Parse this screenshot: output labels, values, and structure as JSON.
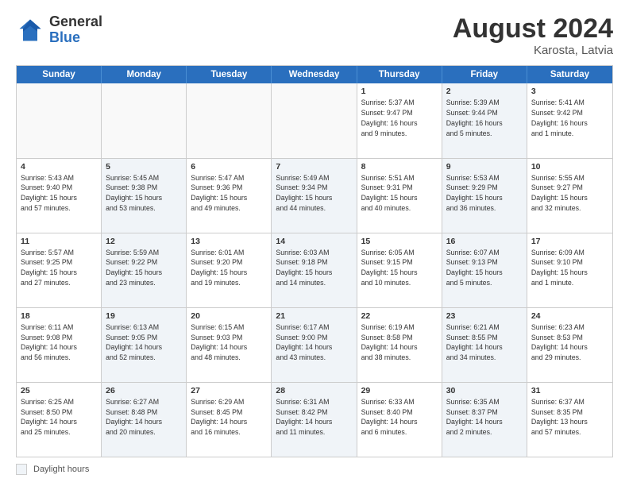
{
  "header": {
    "logo_general": "General",
    "logo_blue": "Blue",
    "month_year": "August 2024",
    "location": "Karosta, Latvia"
  },
  "days_of_week": [
    "Sunday",
    "Monday",
    "Tuesday",
    "Wednesday",
    "Thursday",
    "Friday",
    "Saturday"
  ],
  "weeks": [
    [
      {
        "day": "",
        "info": "",
        "shaded": false,
        "empty": true
      },
      {
        "day": "",
        "info": "",
        "shaded": false,
        "empty": true
      },
      {
        "day": "",
        "info": "",
        "shaded": false,
        "empty": true
      },
      {
        "day": "",
        "info": "",
        "shaded": false,
        "empty": true
      },
      {
        "day": "1",
        "info": "Sunrise: 5:37 AM\nSunset: 9:47 PM\nDaylight: 16 hours\nand 9 minutes.",
        "shaded": false,
        "empty": false
      },
      {
        "day": "2",
        "info": "Sunrise: 5:39 AM\nSunset: 9:44 PM\nDaylight: 16 hours\nand 5 minutes.",
        "shaded": true,
        "empty": false
      },
      {
        "day": "3",
        "info": "Sunrise: 5:41 AM\nSunset: 9:42 PM\nDaylight: 16 hours\nand 1 minute.",
        "shaded": false,
        "empty": false
      }
    ],
    [
      {
        "day": "4",
        "info": "Sunrise: 5:43 AM\nSunset: 9:40 PM\nDaylight: 15 hours\nand 57 minutes.",
        "shaded": false,
        "empty": false
      },
      {
        "day": "5",
        "info": "Sunrise: 5:45 AM\nSunset: 9:38 PM\nDaylight: 15 hours\nand 53 minutes.",
        "shaded": true,
        "empty": false
      },
      {
        "day": "6",
        "info": "Sunrise: 5:47 AM\nSunset: 9:36 PM\nDaylight: 15 hours\nand 49 minutes.",
        "shaded": false,
        "empty": false
      },
      {
        "day": "7",
        "info": "Sunrise: 5:49 AM\nSunset: 9:34 PM\nDaylight: 15 hours\nand 44 minutes.",
        "shaded": true,
        "empty": false
      },
      {
        "day": "8",
        "info": "Sunrise: 5:51 AM\nSunset: 9:31 PM\nDaylight: 15 hours\nand 40 minutes.",
        "shaded": false,
        "empty": false
      },
      {
        "day": "9",
        "info": "Sunrise: 5:53 AM\nSunset: 9:29 PM\nDaylight: 15 hours\nand 36 minutes.",
        "shaded": true,
        "empty": false
      },
      {
        "day": "10",
        "info": "Sunrise: 5:55 AM\nSunset: 9:27 PM\nDaylight: 15 hours\nand 32 minutes.",
        "shaded": false,
        "empty": false
      }
    ],
    [
      {
        "day": "11",
        "info": "Sunrise: 5:57 AM\nSunset: 9:25 PM\nDaylight: 15 hours\nand 27 minutes.",
        "shaded": false,
        "empty": false
      },
      {
        "day": "12",
        "info": "Sunrise: 5:59 AM\nSunset: 9:22 PM\nDaylight: 15 hours\nand 23 minutes.",
        "shaded": true,
        "empty": false
      },
      {
        "day": "13",
        "info": "Sunrise: 6:01 AM\nSunset: 9:20 PM\nDaylight: 15 hours\nand 19 minutes.",
        "shaded": false,
        "empty": false
      },
      {
        "day": "14",
        "info": "Sunrise: 6:03 AM\nSunset: 9:18 PM\nDaylight: 15 hours\nand 14 minutes.",
        "shaded": true,
        "empty": false
      },
      {
        "day": "15",
        "info": "Sunrise: 6:05 AM\nSunset: 9:15 PM\nDaylight: 15 hours\nand 10 minutes.",
        "shaded": false,
        "empty": false
      },
      {
        "day": "16",
        "info": "Sunrise: 6:07 AM\nSunset: 9:13 PM\nDaylight: 15 hours\nand 5 minutes.",
        "shaded": true,
        "empty": false
      },
      {
        "day": "17",
        "info": "Sunrise: 6:09 AM\nSunset: 9:10 PM\nDaylight: 15 hours\nand 1 minute.",
        "shaded": false,
        "empty": false
      }
    ],
    [
      {
        "day": "18",
        "info": "Sunrise: 6:11 AM\nSunset: 9:08 PM\nDaylight: 14 hours\nand 56 minutes.",
        "shaded": false,
        "empty": false
      },
      {
        "day": "19",
        "info": "Sunrise: 6:13 AM\nSunset: 9:05 PM\nDaylight: 14 hours\nand 52 minutes.",
        "shaded": true,
        "empty": false
      },
      {
        "day": "20",
        "info": "Sunrise: 6:15 AM\nSunset: 9:03 PM\nDaylight: 14 hours\nand 48 minutes.",
        "shaded": false,
        "empty": false
      },
      {
        "day": "21",
        "info": "Sunrise: 6:17 AM\nSunset: 9:00 PM\nDaylight: 14 hours\nand 43 minutes.",
        "shaded": true,
        "empty": false
      },
      {
        "day": "22",
        "info": "Sunrise: 6:19 AM\nSunset: 8:58 PM\nDaylight: 14 hours\nand 38 minutes.",
        "shaded": false,
        "empty": false
      },
      {
        "day": "23",
        "info": "Sunrise: 6:21 AM\nSunset: 8:55 PM\nDaylight: 14 hours\nand 34 minutes.",
        "shaded": true,
        "empty": false
      },
      {
        "day": "24",
        "info": "Sunrise: 6:23 AM\nSunset: 8:53 PM\nDaylight: 14 hours\nand 29 minutes.",
        "shaded": false,
        "empty": false
      }
    ],
    [
      {
        "day": "25",
        "info": "Sunrise: 6:25 AM\nSunset: 8:50 PM\nDaylight: 14 hours\nand 25 minutes.",
        "shaded": false,
        "empty": false
      },
      {
        "day": "26",
        "info": "Sunrise: 6:27 AM\nSunset: 8:48 PM\nDaylight: 14 hours\nand 20 minutes.",
        "shaded": true,
        "empty": false
      },
      {
        "day": "27",
        "info": "Sunrise: 6:29 AM\nSunset: 8:45 PM\nDaylight: 14 hours\nand 16 minutes.",
        "shaded": false,
        "empty": false
      },
      {
        "day": "28",
        "info": "Sunrise: 6:31 AM\nSunset: 8:42 PM\nDaylight: 14 hours\nand 11 minutes.",
        "shaded": true,
        "empty": false
      },
      {
        "day": "29",
        "info": "Sunrise: 6:33 AM\nSunset: 8:40 PM\nDaylight: 14 hours\nand 6 minutes.",
        "shaded": false,
        "empty": false
      },
      {
        "day": "30",
        "info": "Sunrise: 6:35 AM\nSunset: 8:37 PM\nDaylight: 14 hours\nand 2 minutes.",
        "shaded": true,
        "empty": false
      },
      {
        "day": "31",
        "info": "Sunrise: 6:37 AM\nSunset: 8:35 PM\nDaylight: 13 hours\nand 57 minutes.",
        "shaded": false,
        "empty": false
      }
    ]
  ],
  "footer": {
    "daylight_label": "Daylight hours"
  }
}
